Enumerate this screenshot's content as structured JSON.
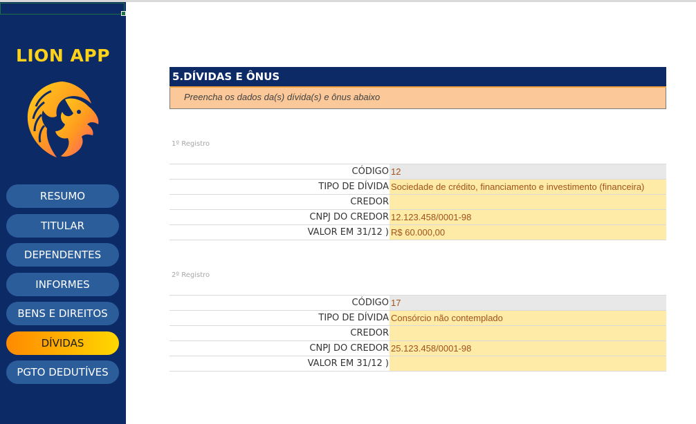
{
  "app": {
    "title": "LION APP",
    "logo_icon": "lion-head-icon"
  },
  "colors": {
    "sidebar_bg": "#0c2a66",
    "nav_button": "#2b5d9b",
    "nav_active": "#ffb300",
    "accent_title": "#ffd21a",
    "header_bg": "#0c2a66",
    "subheader_bg": "#fbc89a",
    "input_bg": "#ffeba8",
    "value_text": "#a0521a"
  },
  "nav": [
    {
      "label": "RESUMO",
      "active": false
    },
    {
      "label": "TITULAR",
      "active": false
    },
    {
      "label": "DEPENDENTES",
      "active": false
    },
    {
      "label": "INFORMES",
      "active": false
    },
    {
      "label": "BENS E DIREITOS",
      "active": false
    },
    {
      "label": "DÍVIDAS",
      "active": true
    },
    {
      "label": "PGTO DEDUTÍVES",
      "active": false
    }
  ],
  "section": {
    "title": "5.DÍVIDAS E ÔNUS",
    "subtitle": "Preencha os dados da(s) dívida(s) e ônus abaixo"
  },
  "records": [
    {
      "label": "1º Registro",
      "fields": [
        {
          "label": "CÓDIGO",
          "value": "12"
        },
        {
          "label": "TIPO DE DÍVIDA",
          "value": "Sociedade de crédito, financiamento e investimento (financeira)"
        },
        {
          "label": "CREDOR",
          "value": ""
        },
        {
          "label": "CNPJ DO CREDOR",
          "value": "12.123.458/0001-98"
        },
        {
          "label": "VALOR EM 31/12 )",
          "value": "R$ 60.000,00"
        }
      ]
    },
    {
      "label": "2º Registro",
      "fields": [
        {
          "label": "CÓDIGO",
          "value": "17"
        },
        {
          "label": "TIPO DE DÍVIDA",
          "value": "Consórcio não contemplado"
        },
        {
          "label": "CREDOR",
          "value": ""
        },
        {
          "label": "CNPJ DO CREDOR",
          "value": "25.123.458/0001-98"
        },
        {
          "label": "VALOR EM 31/12 )",
          "value": ""
        }
      ]
    }
  ]
}
